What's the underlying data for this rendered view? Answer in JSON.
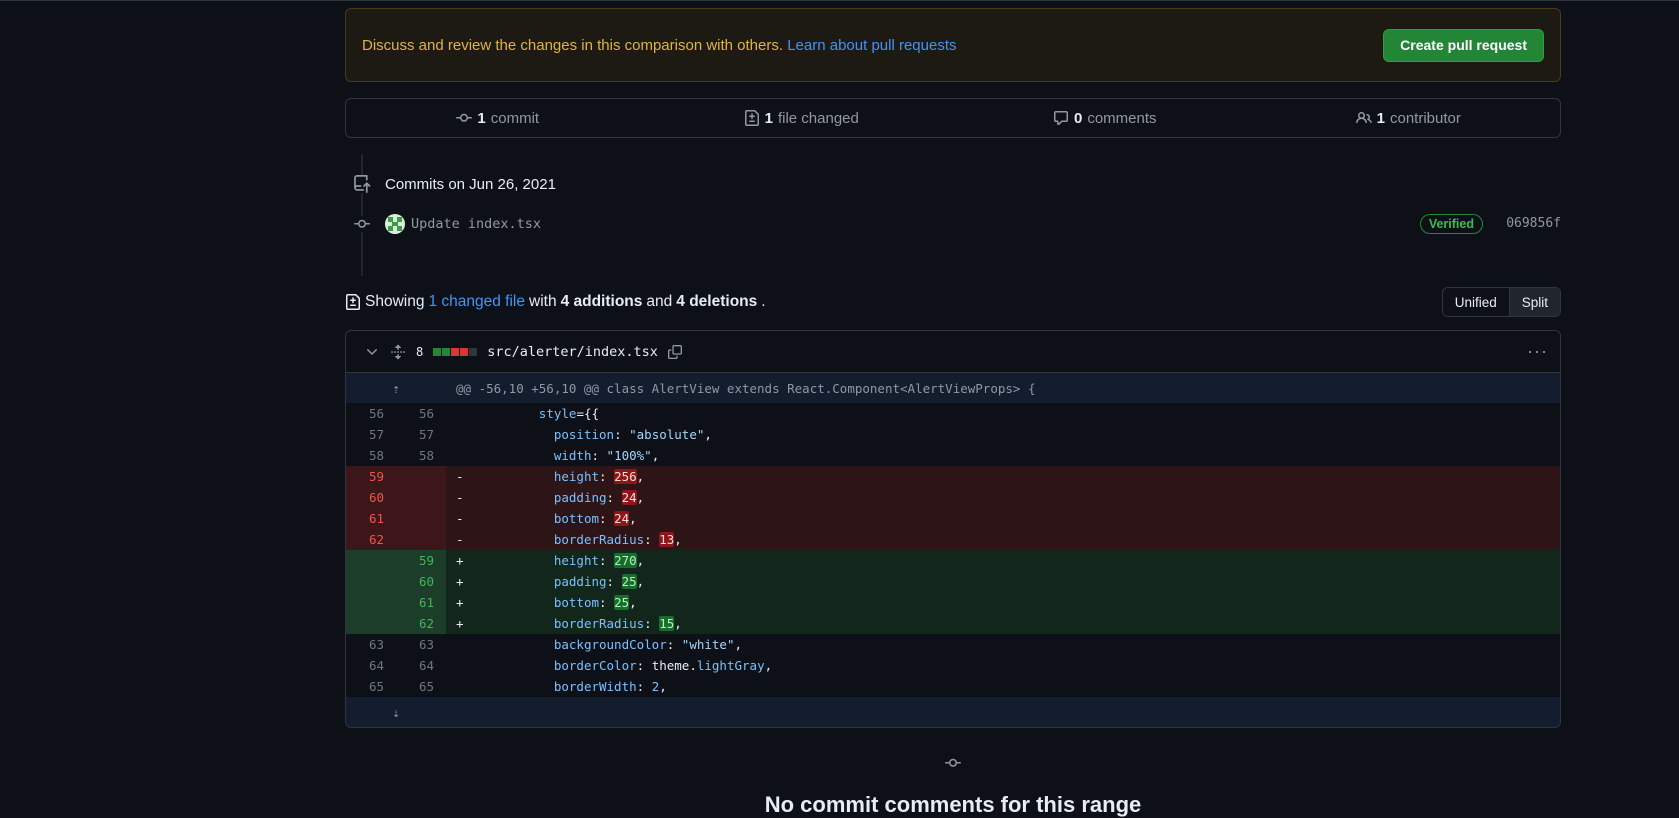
{
  "flash": {
    "message": "Discuss and review the changes in this comparison with others.",
    "link": "Learn about pull requests",
    "button": "Create pull request"
  },
  "summary": {
    "commits_count": "1",
    "commits_label": "commit",
    "files_count": "1",
    "files_label": "file changed",
    "comments_count": "0",
    "comments_label": "comments",
    "contributors_count": "1",
    "contributors_label": "contributor"
  },
  "commits": {
    "heading": "Commits on Jun 26, 2021",
    "items": [
      {
        "message": "Update index.tsx",
        "badge": "Verified",
        "sha": "069856f"
      }
    ]
  },
  "toc": {
    "showing": "Showing",
    "changed_files": "1 changed file",
    "with": "with",
    "additions": "4 additions",
    "and": "and",
    "deletions": "4 deletions",
    "view_unified": "Unified",
    "view_split": "Split"
  },
  "file": {
    "changes": "8",
    "path": "src/alerter/index.tsx",
    "hunk": "@@ -56,10 +56,10 @@ class AlertView extends React.Component<AlertViewProps> {"
  },
  "colors": {
    "background": "#0d1117",
    "accent_link": "#4493f8",
    "primary_button": "#238636",
    "deletion": "#f85149",
    "addition": "#3fb950",
    "warning": "#e3b341"
  },
  "empty_state": {
    "title": "No commit comments for this range"
  }
}
